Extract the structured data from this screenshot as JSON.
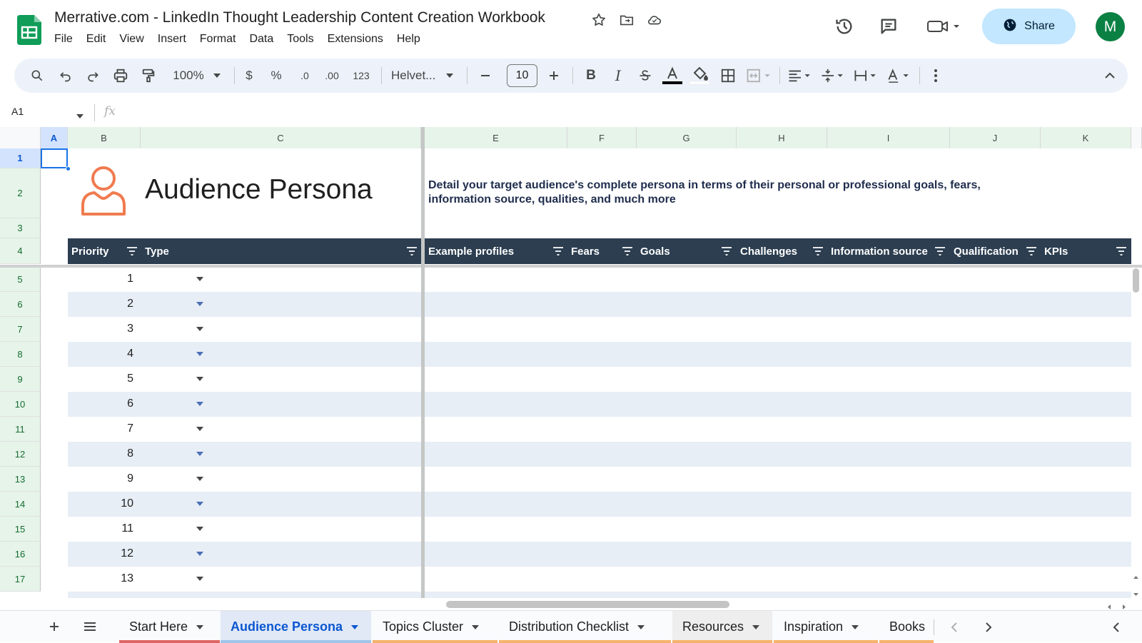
{
  "doc": {
    "title": "Merrative.com - LinkedIn Thought Leadership Content Creation Workbook"
  },
  "menu": [
    "File",
    "Edit",
    "View",
    "Insert",
    "Format",
    "Data",
    "Tools",
    "Extensions",
    "Help"
  ],
  "share_label": "Share",
  "avatar_letter": "M",
  "toolbar": {
    "zoom": "100%",
    "currency": "$",
    "percent": "%",
    "dec_decrease": ".0",
    "dec_increase": ".00",
    "number_format": "123",
    "font": "Helvet...",
    "font_size": "10",
    "bold": "B",
    "italic": "I"
  },
  "formula_bar": {
    "cell_ref": "A1",
    "fx": "fx"
  },
  "columns": [
    "A",
    "B",
    "C",
    "E",
    "F",
    "G",
    "H",
    "I",
    "J",
    "K"
  ],
  "rows": [
    "1",
    "2",
    "3",
    "4",
    "5",
    "6",
    "7",
    "8",
    "9",
    "10",
    "11",
    "12",
    "13",
    "14",
    "15",
    "16",
    "17"
  ],
  "sheet": {
    "title": "Audience Persona",
    "description": "Detail your target audience's complete persona in terms of their personal or professional goals, fears, information source, qualities, and much more",
    "headers": [
      "Priority",
      "Type",
      "Example profiles",
      "Fears",
      "Goals",
      "Challenges",
      "Information source",
      "Qualification",
      "KPIs"
    ],
    "priorities": [
      "1",
      "2",
      "3",
      "4",
      "5",
      "6",
      "7",
      "8",
      "9",
      "10",
      "11",
      "12",
      "13"
    ]
  },
  "tabs": [
    {
      "label": "Start Here",
      "color": "#e06666"
    },
    {
      "label": "Audience Persona",
      "color": "#9fc5e8"
    },
    {
      "label": "Topics Cluster",
      "color": "#f6b26b"
    },
    {
      "label": "Distribution Checklist",
      "color": "#f6b26b"
    },
    {
      "label": "Resources",
      "color": "#f6b26b"
    },
    {
      "label": "Inspiration",
      "color": "#f6b26b"
    },
    {
      "label": "Books",
      "color": "#f6b26b"
    }
  ],
  "colors": {
    "header_bg": "#2c3e50",
    "alt_row": "#e8eef6",
    "accent_orange": "#f07b4f",
    "share_bg": "#c2e7ff"
  }
}
